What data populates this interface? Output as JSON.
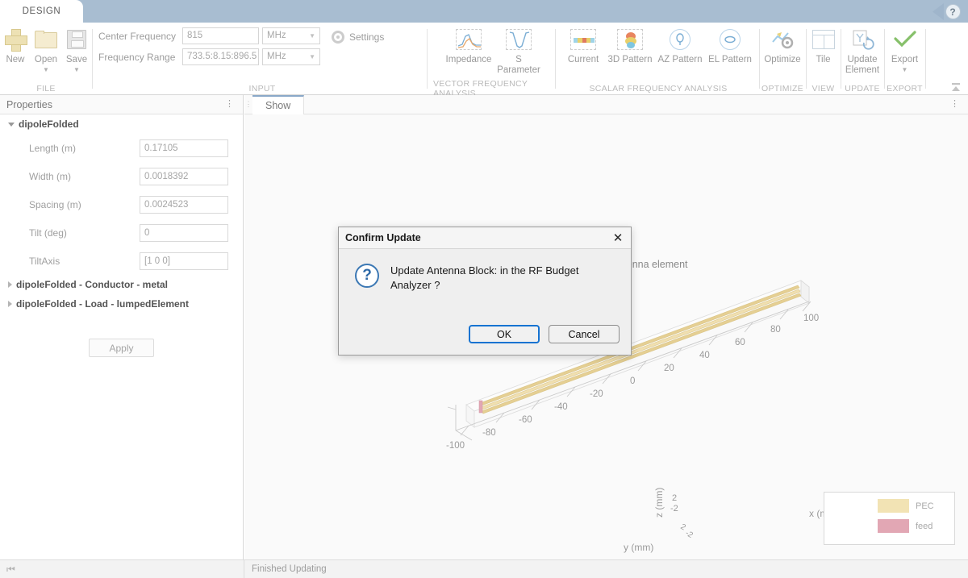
{
  "window": {
    "tab_label": "DESIGN",
    "help_icon": "help-question-icon"
  },
  "ribbon": {
    "groups": [
      {
        "label": "FILE",
        "buttons": [
          {
            "label": "New",
            "icon": "plus-icon",
            "has_caret": false
          },
          {
            "label": "Open",
            "icon": "folder-icon",
            "has_caret": true
          },
          {
            "label": "Save",
            "icon": "floppy-disk-icon",
            "has_caret": true
          }
        ]
      },
      {
        "label": "INPUT",
        "fields": [
          {
            "label": "Center Frequency",
            "value": "815",
            "unit": "MHz"
          },
          {
            "label": "Frequency Range",
            "value": "733.5:8.15:896.5",
            "unit": "MHz"
          }
        ],
        "settings_label": "Settings",
        "settings_icon": "gear-icon"
      },
      {
        "label": "VECTOR FREQUENCY ANALYSIS",
        "buttons": [
          {
            "label": "Impedance",
            "icon": "impedance-plot-icon"
          },
          {
            "label": "S Parameter",
            "icon": "s-parameter-plot-icon"
          }
        ]
      },
      {
        "label": "SCALAR FREQUENCY ANALYSIS",
        "buttons": [
          {
            "label": "Current",
            "icon": "current-distribution-icon"
          },
          {
            "label": "3D Pattern",
            "icon": "pattern-3d-icon"
          },
          {
            "label": "AZ Pattern",
            "icon": "azimuth-pattern-icon"
          },
          {
            "label": "EL Pattern",
            "icon": "elevation-pattern-icon"
          }
        ]
      },
      {
        "label": "OPTIMIZE",
        "buttons": [
          {
            "label": "Optimize",
            "icon": "optimize-icon"
          }
        ]
      },
      {
        "label": "VIEW",
        "buttons": [
          {
            "label": "Tile",
            "icon": "tile-layout-icon"
          }
        ]
      },
      {
        "label": "UPDATE",
        "buttons": [
          {
            "label": "Update Element",
            "icon": "update-element-icon"
          }
        ]
      },
      {
        "label": "EXPORT",
        "buttons": [
          {
            "label": "Export",
            "icon": "green-check-icon",
            "has_caret": true
          }
        ]
      }
    ],
    "collapse_icon": "collapse-ribbon-icon"
  },
  "properties": {
    "title": "Properties",
    "overflow_icon": "vertical-dots-icon",
    "root_node": "dipoleFolded",
    "rows": [
      {
        "label": "Length (m)",
        "value": "0.17105"
      },
      {
        "label": "Width (m)",
        "value": "0.0018392"
      },
      {
        "label": "Spacing (m)",
        "value": "0.0024523"
      },
      {
        "label": "Tilt (deg)",
        "value": "0"
      },
      {
        "label": "TiltAxis",
        "value": "[1 0 0]"
      }
    ],
    "child_nodes": [
      "dipoleFolded - Conductor - metal",
      "dipoleFolded - Load - lumpedElement"
    ],
    "apply_label": "Apply"
  },
  "view": {
    "grip_icon": "drag-grip-icon",
    "tab_label": "Show",
    "overflow_icon": "vertical-dots-icon",
    "plot": {
      "title": "Antenna element",
      "xlabel": "x (mm)",
      "ylabel": "y (mm)",
      "zlabel": "z (mm)",
      "x_ticks": [
        "-100",
        "-80",
        "-60",
        "-40",
        "-20",
        "0",
        "20",
        "40",
        "60",
        "80",
        "100"
      ],
      "z_ticks": [
        "2",
        "-2"
      ],
      "y_ticks": [
        "2",
        "-2"
      ],
      "legend": [
        {
          "label": "PEC",
          "color": "#f2e3b4"
        },
        {
          "label": "feed",
          "color": "#e2a7b4"
        }
      ]
    }
  },
  "dialog": {
    "title": "Confirm Update",
    "close_icon": "close-x-icon",
    "question_icon": "question-mark-icon",
    "message": "Update Antenna Block: in the RF Budget Analyzer ?",
    "ok_label": "OK",
    "cancel_label": "Cancel"
  },
  "statusbar": {
    "nav_icon": "jump-to-start-icon",
    "text": "Finished Updating"
  }
}
